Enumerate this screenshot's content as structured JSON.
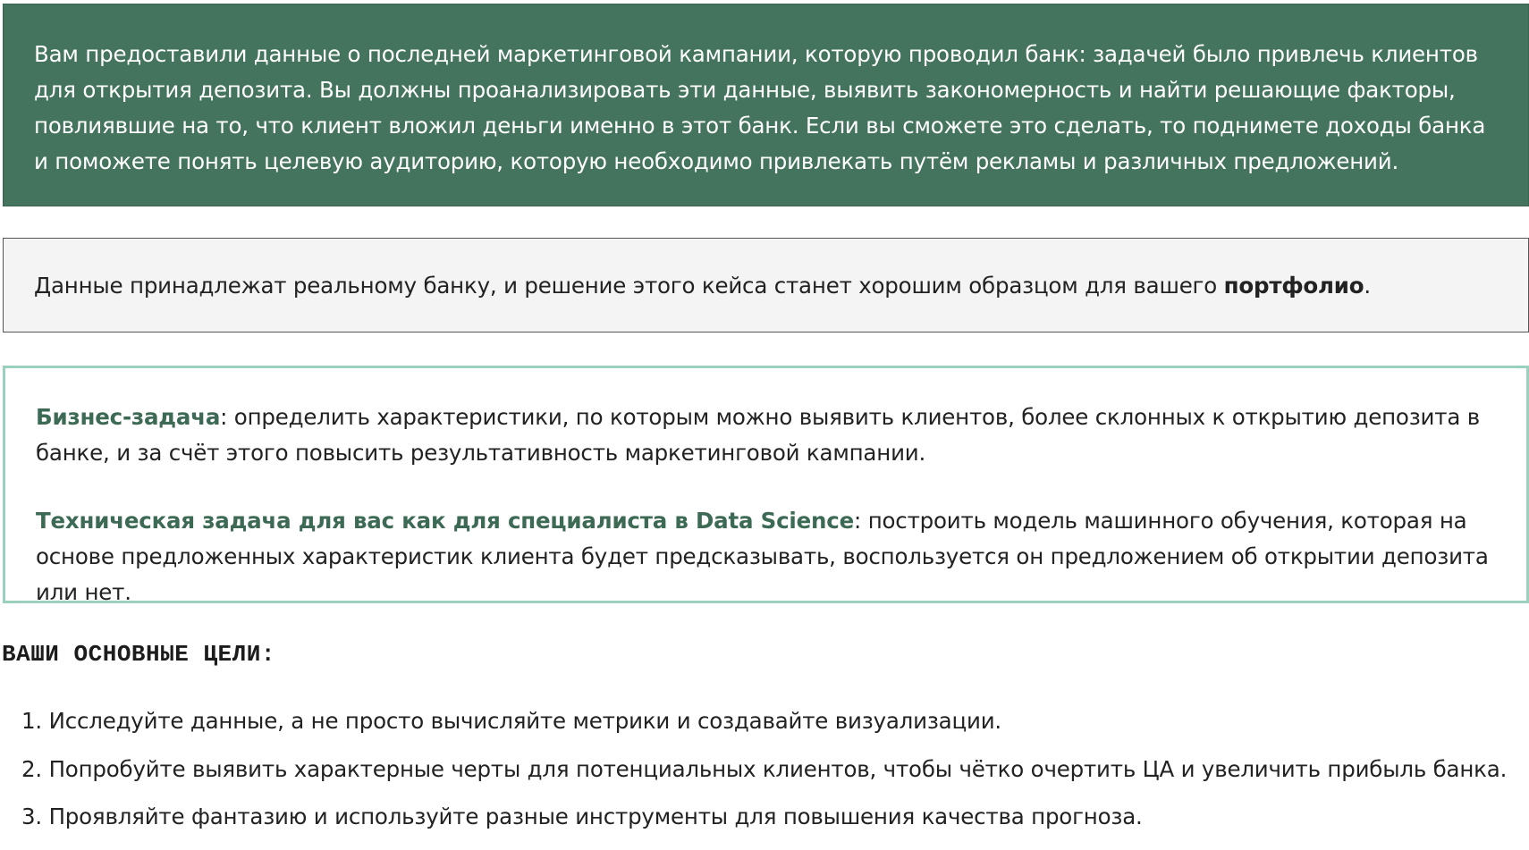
{
  "intro_box": {
    "text": "Вам предоставили данные о последней маркетинговой кампании, которую проводил банк: задачей было привлечь клиентов для открытия депозита. Вы должны проанализировать эти данные, выявить закономерность и найти решающие факторы, повлиявшие на то, что клиент вложил деньги именно в этот банк. Если вы сможете это сделать, то поднимете доходы банка и поможете понять целевую аудиторию, которую необходимо привлекать путём рекламы и различных предложений.",
    "background_color": "#44745d"
  },
  "note_box": {
    "text_before": "Данные принадлежат реальному банку, и решение этого кейса станет хорошим образцом для вашего ",
    "bold_text": "портфолио",
    "text_after": "."
  },
  "tasks": {
    "business": {
      "label": "Бизнес-задача",
      "text": ": определить характеристики, по которым можно выявить клиентов, более склонных к открытию депозита в банке, и за счёт этого повысить результативность маркетинговой кампании."
    },
    "technical": {
      "label": "Техническая задача для вас как для специалиста в Data Science",
      "text": ": построить модель машинного обучения, которая на основе предложенных характеристик клиента будет предсказывать, воспользуется он предложением об открытии депозита или нет."
    },
    "accent_color": "#3d6a55",
    "border_color": "#9bd0bc"
  },
  "goals": {
    "heading": "ВАШИ ОСНОВНЫЕ ЦЕЛИ:",
    "items": [
      "1. Исследуйте данные, а не просто вычисляйте метрики и создавайте визуализации.",
      "2. Попробуйте выявить характерные черты для потенциальных клиентов, чтобы чётко очертить ЦА и увеличить прибыль банка.",
      "3. Проявляйте фантазию и используйте разные инструменты для повышения качества прогноза."
    ]
  }
}
